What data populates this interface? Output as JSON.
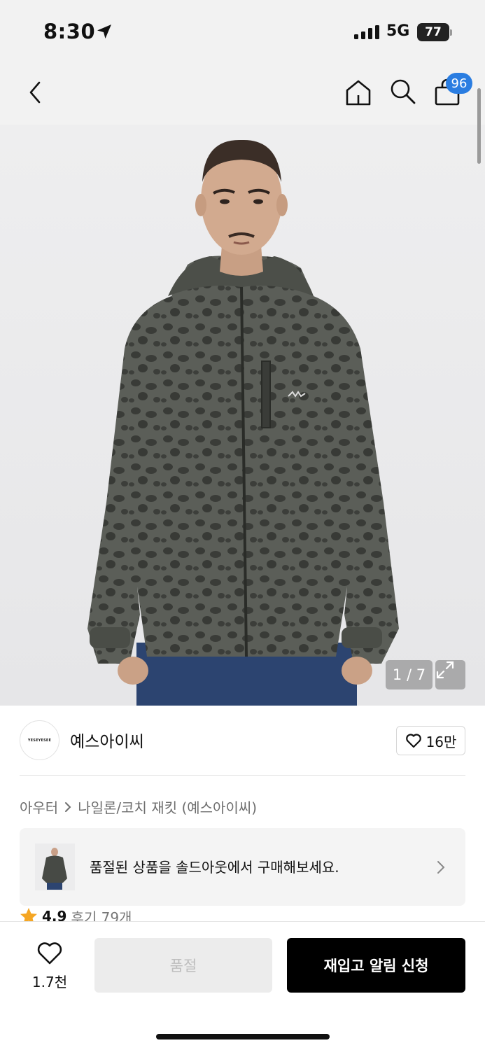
{
  "status_bar": {
    "time": "8:30",
    "network": "5G",
    "battery": "77"
  },
  "nav": {
    "cart_badge": "96",
    "icons": [
      "chevron-left-icon",
      "home-icon",
      "search-icon",
      "shopping-bag-icon"
    ]
  },
  "gallery": {
    "pager": "1 / 7"
  },
  "brand": {
    "logo_text": "YESEYESEE",
    "name": "예스아이씨",
    "likes": "16만"
  },
  "breadcrumb": {
    "category": "아우터",
    "subcategory": "나일론/코치 재킷 (예스아이씨)"
  },
  "soldout_banner": {
    "text": "품절된 상품을 솔드아웃에서 구매해보세요."
  },
  "rating": {
    "score": "4.9",
    "reviews": "후기 79개"
  },
  "bottom_bar": {
    "wish_count": "1.7천",
    "soldout_label": "품절",
    "restock_label": "재입고 알림 신청"
  },
  "colors": {
    "accent_blue": "#2a7de1",
    "star": "#f5a623",
    "primary_button": "#000000",
    "disabled_button": "#ececec"
  }
}
